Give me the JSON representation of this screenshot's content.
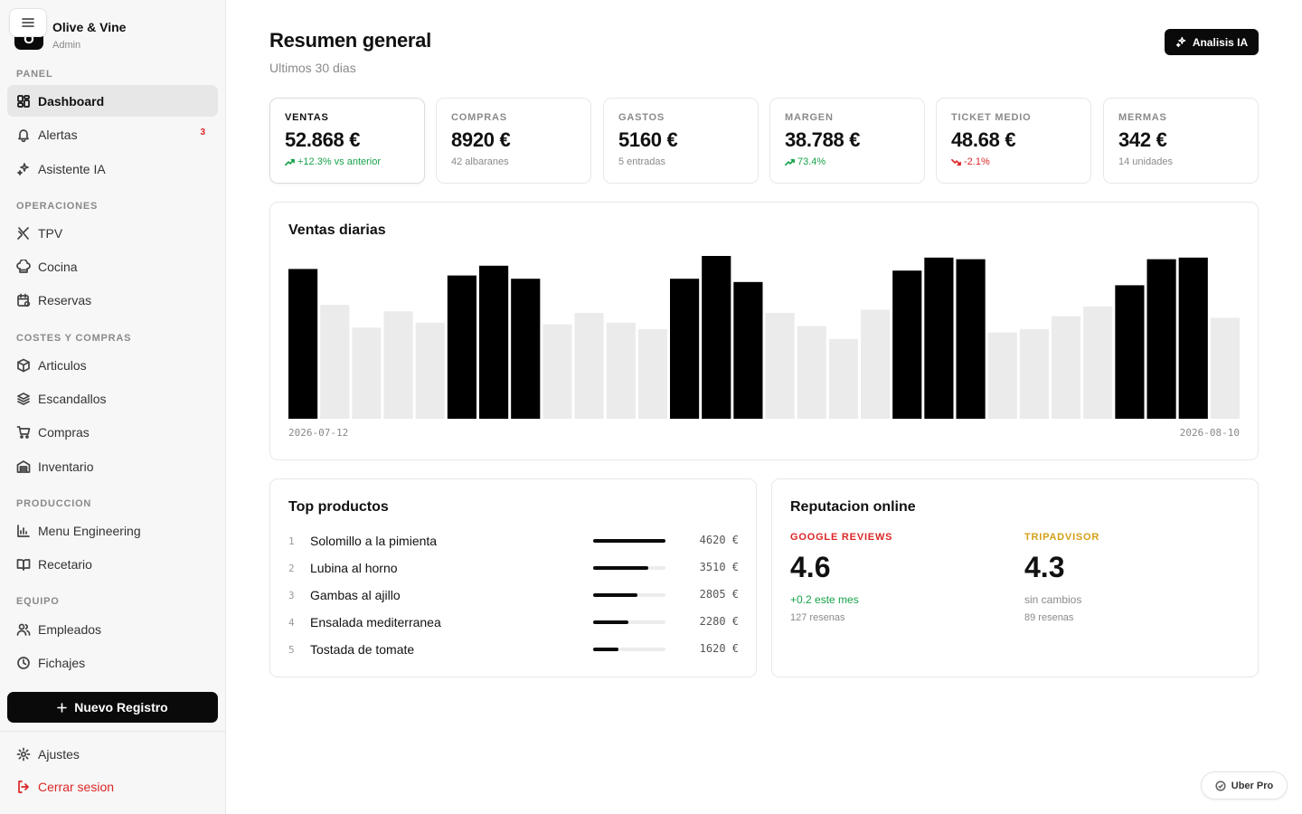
{
  "brand": {
    "initial": "O",
    "name": "Olive & Vine",
    "role": "Admin"
  },
  "sidebar": {
    "sections": [
      {
        "label": "PANEL",
        "items": [
          {
            "label": "Dashboard",
            "icon": "dashboard-icon",
            "active": true
          },
          {
            "label": "Alertas",
            "icon": "bell-icon",
            "badge": "3"
          },
          {
            "label": "Asistente IA",
            "icon": "sparkles-icon"
          }
        ]
      },
      {
        "label": "OPERACIONES",
        "items": [
          {
            "label": "TPV",
            "icon": "utensils-icon"
          },
          {
            "label": "Cocina",
            "icon": "chef-hat-icon"
          },
          {
            "label": "Reservas",
            "icon": "calendar-icon"
          }
        ]
      },
      {
        "label": "COSTES Y COMPRAS",
        "items": [
          {
            "label": "Articulos",
            "icon": "box-icon"
          },
          {
            "label": "Escandallos",
            "icon": "layers-icon"
          },
          {
            "label": "Compras",
            "icon": "cart-icon"
          },
          {
            "label": "Inventario",
            "icon": "warehouse-icon"
          }
        ]
      },
      {
        "label": "PRODUCCION",
        "items": [
          {
            "label": "Menu Engineering",
            "icon": "bar-chart-icon"
          },
          {
            "label": "Recetario",
            "icon": "book-icon"
          }
        ]
      },
      {
        "label": "EQUIPO",
        "items": [
          {
            "label": "Empleados",
            "icon": "users-icon"
          },
          {
            "label": "Fichajes",
            "icon": "clock-icon"
          }
        ]
      }
    ],
    "new_record_label": "Nuevo Registro",
    "settings_label": "Ajustes",
    "logout_label": "Cerrar sesion"
  },
  "header": {
    "title": "Resumen general",
    "subtitle": "Ultimos 30 dias",
    "ai_button_label": "Analisis IA"
  },
  "kpis": [
    {
      "label": "VENTAS",
      "value": "52.868 €",
      "sub": "+12.3% vs anterior",
      "trend": "up"
    },
    {
      "label": "COMPRAS",
      "value": "8920 €",
      "sub": "42 albaranes",
      "trend": "none"
    },
    {
      "label": "GASTOS",
      "value": "5160 €",
      "sub": "5 entradas",
      "trend": "none"
    },
    {
      "label": "MARGEN",
      "value": "38.788 €",
      "sub": "73.4%",
      "trend": "up"
    },
    {
      "label": "TICKET MEDIO",
      "value": "48.68 €",
      "sub": "-2.1%",
      "trend": "down"
    },
    {
      "label": "MERMAS",
      "value": "342 €",
      "sub": "14 unidades",
      "trend": "none"
    }
  ],
  "daily_sales": {
    "title": "Ventas diarias",
    "start_label": "2026-07-12",
    "end_label": "2026-08-10"
  },
  "chart_data": {
    "type": "bar",
    "title": "Ventas diarias",
    "x_start": "2026-07-12",
    "x_end": "2026-08-10",
    "values": [
      92,
      70,
      56,
      66,
      59,
      88,
      94,
      86,
      58,
      65,
      59,
      55,
      86,
      100,
      84,
      65,
      57,
      49,
      67,
      91,
      99,
      98,
      53,
      55,
      63,
      69,
      82,
      98,
      99,
      62
    ],
    "highlighted": [
      true,
      false,
      false,
      false,
      false,
      true,
      true,
      true,
      false,
      false,
      false,
      false,
      true,
      true,
      true,
      false,
      false,
      false,
      false,
      true,
      true,
      true,
      false,
      false,
      false,
      false,
      true,
      true,
      true,
      false
    ],
    "colors": {
      "highlight": "#000000",
      "normal": "#ebebeb"
    }
  },
  "top_products": {
    "title": "Top productos",
    "items": [
      {
        "rank": "1",
        "name": "Solomillo a la pimienta",
        "value": "4620 €",
        "ratio": 1.0
      },
      {
        "rank": "2",
        "name": "Lubina al horno",
        "value": "3510 €",
        "ratio": 0.76
      },
      {
        "rank": "3",
        "name": "Gambas al ajillo",
        "value": "2805 €",
        "ratio": 0.61
      },
      {
        "rank": "4",
        "name": "Ensalada mediterranea",
        "value": "2280 €",
        "ratio": 0.49
      },
      {
        "rank": "5",
        "name": "Tostada de tomate",
        "value": "1620 €",
        "ratio": 0.35
      }
    ]
  },
  "reputation": {
    "title": "Reputacion online",
    "google": {
      "source": "GOOGLE REVIEWS",
      "score": "4.6",
      "change": "+0.2 este mes",
      "count": "127 resenas",
      "color": "#dc2626",
      "change_color": "#16a34a"
    },
    "tripadvisor": {
      "source": "TRIPADVISOR",
      "score": "4.3",
      "change": "sin cambios",
      "count": "89 resenas",
      "color": "#d4a017",
      "change_color": "#8a8a8a"
    }
  },
  "uber_pill": {
    "label": "Uber Pro"
  }
}
